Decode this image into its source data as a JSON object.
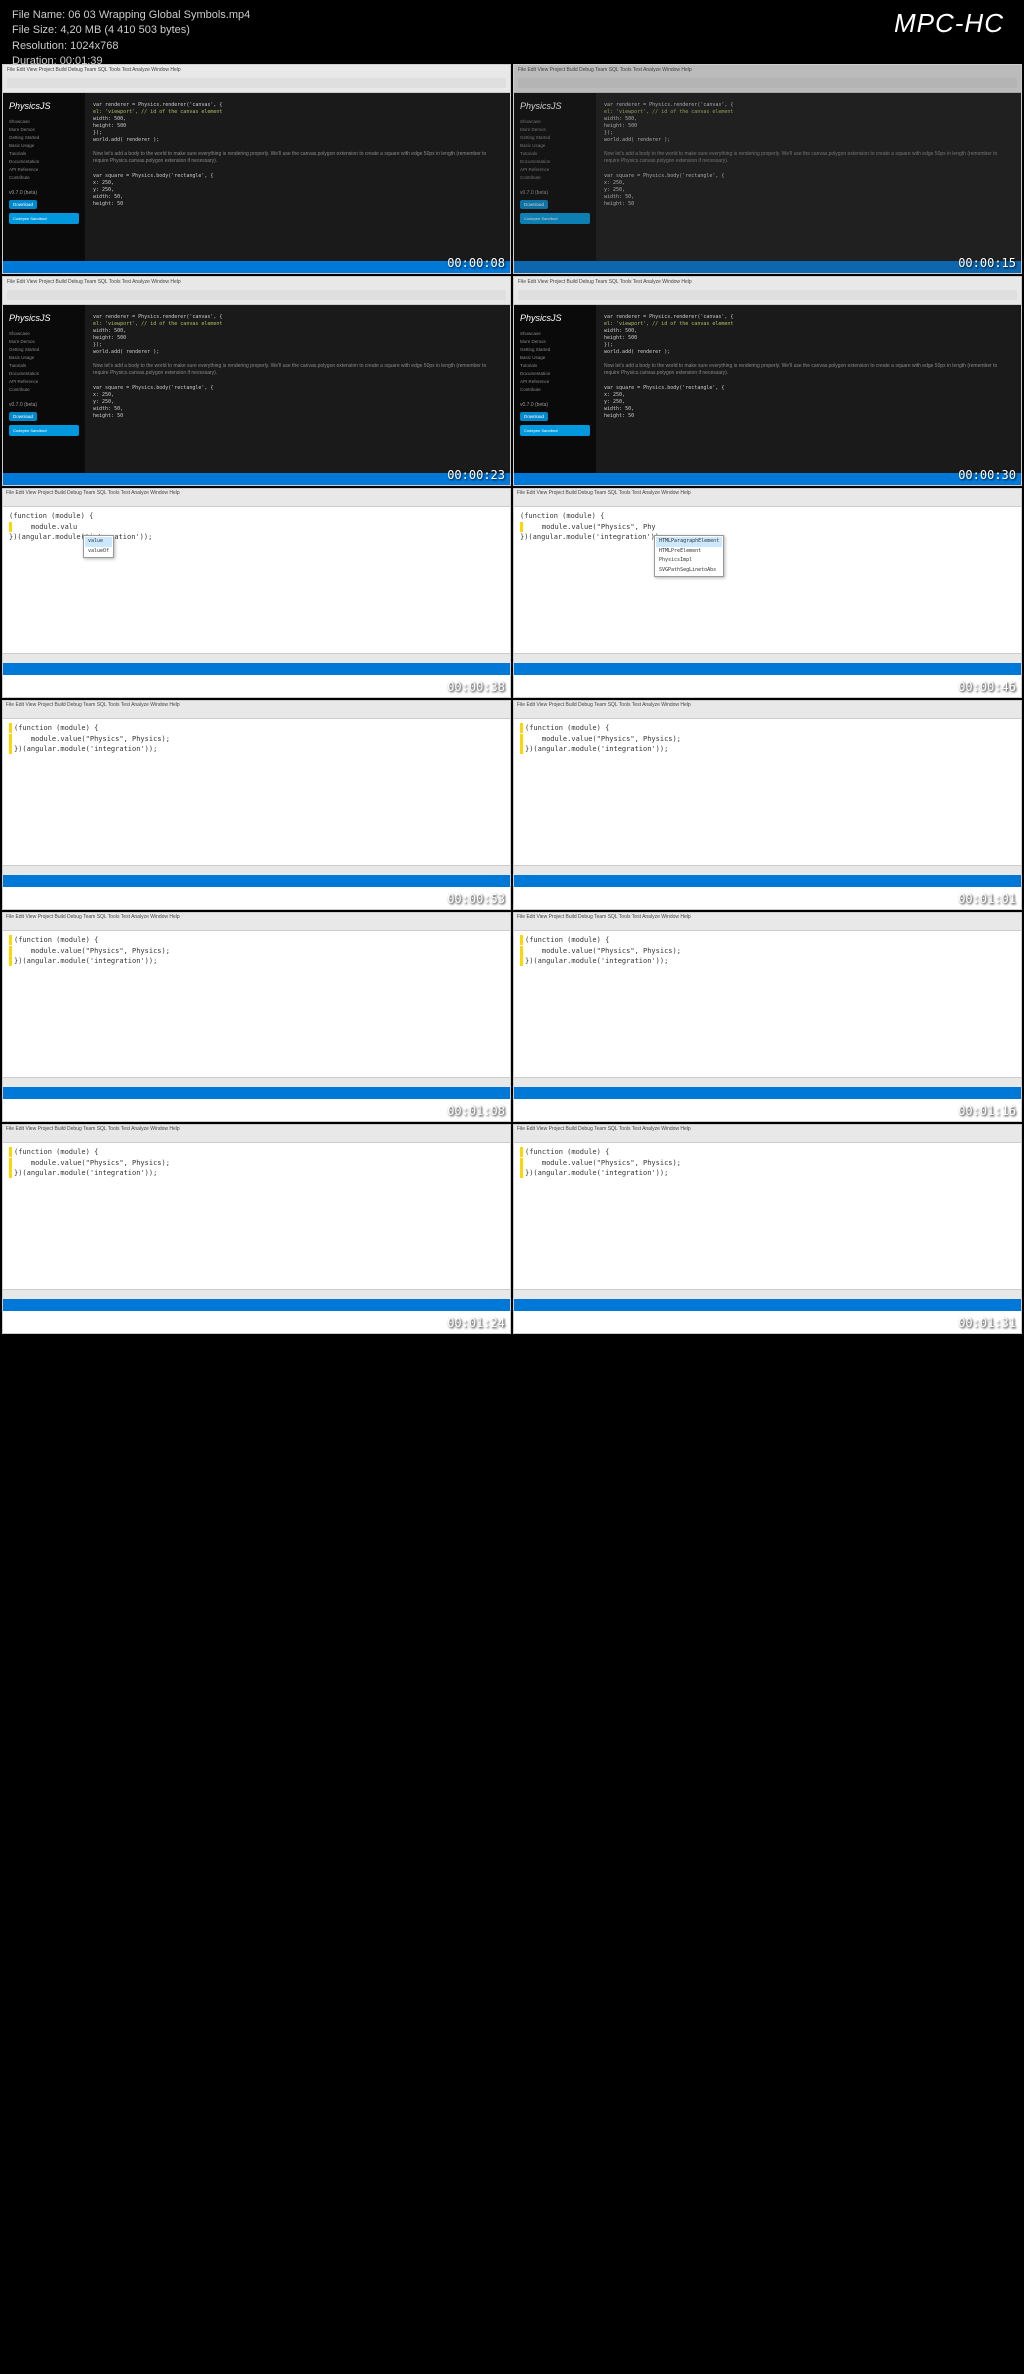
{
  "header": {
    "file_name_label": "File Name:",
    "file_name": "06 03 Wrapping Global Symbols.mp4",
    "file_size_label": "File Size:",
    "file_size": "4,20 MB (4 410 503 bytes)",
    "resolution_label": "Resolution:",
    "resolution": "1024x768",
    "duration_label": "Duration:",
    "duration": "00:01:39",
    "app_name": "MPC-HC"
  },
  "menu_items": "File  Edit  View  Project  Build  Debug  Team  SQL  Tools  Test  Analyze  Window  Help",
  "physicsjs": {
    "title": "PhysicsJS",
    "nav": [
      "Showcase",
      "More Demos",
      "Getting Started",
      "Basic Usage",
      "Tutorials",
      "Documentation",
      "API Reference",
      "Contribute"
    ],
    "version": "v0.7.0 (beta)",
    "download": "Download",
    "codepen": "Codepen Sandbox!",
    "code1": "var renderer = Physics.renderer('canvas', {",
    "code2": "    el: 'viewport', // id of the canvas element",
    "code3": "    width: 500,",
    "code4": "    height: 500",
    "code5": "});",
    "code6": "world.add( renderer );",
    "para": "Now let's add a body to the world to make sure everything is rendering properly. We'll use the canvas.polygon extension to create a square with edge 50px in length (remember to require Physics.canvas.polygon extension if necessary).",
    "code7": "var square = Physics.body('rectangle', {",
    "code8": "    x: 250,",
    "code9": "    y: 250,",
    "code10": "    width: 50,",
    "code11": "    height: 50"
  },
  "ide": {
    "line1": "(function (module) {",
    "line2_partial": "    module.valu",
    "line2_phy": "    module.value(\"Physics\", Phy",
    "line2_full": "    module.value(\"Physics\", Physics);",
    "line3": "})(angular.module('integration'));",
    "line3_partial": "})(angular.module('integration'));",
    "autocomplete1": [
      "value",
      "valueOf"
    ],
    "autocomplete2": [
      "HTMLParagraphElement",
      "HTMLPreElement",
      "PhysicsImpl",
      "SVGPathSegLinetoAbs"
    ]
  },
  "timestamps": [
    "00:00:08",
    "00:00:15",
    "00:00:23",
    "00:00:30",
    "00:00:38",
    "00:00:46",
    "00:00:53",
    "00:01:01",
    "00:01:08",
    "00:01:16",
    "00:01:24",
    "00:01:31"
  ]
}
